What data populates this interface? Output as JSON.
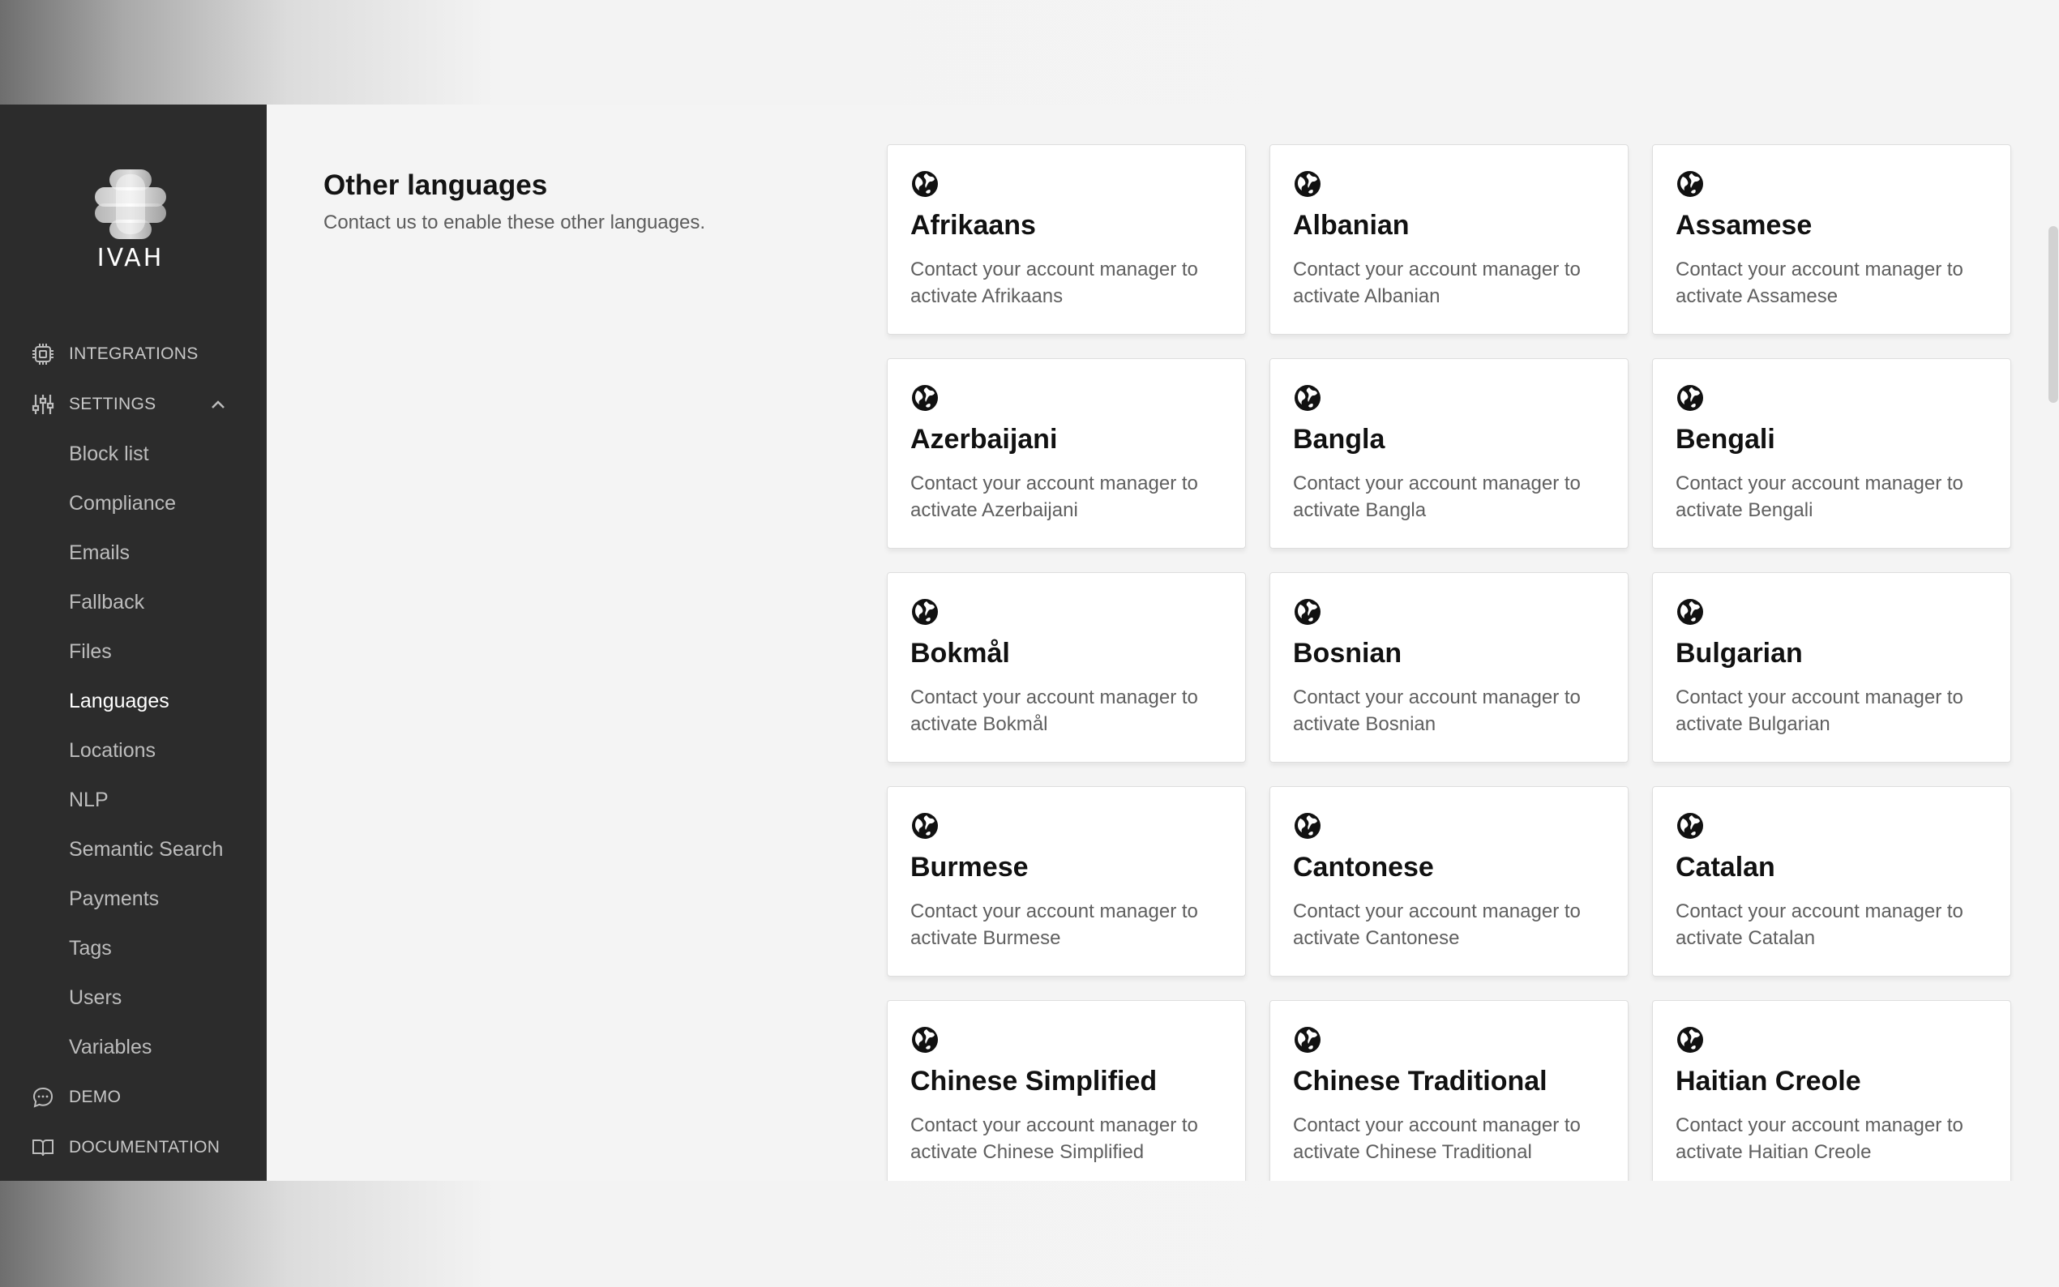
{
  "brand": {
    "name": "IVAH"
  },
  "nav": {
    "integrations": "INTEGRATIONS",
    "settings": "SETTINGS",
    "settings_items": [
      "Block list",
      "Compliance",
      "Emails",
      "Fallback",
      "Files",
      "Languages",
      "Locations",
      "NLP",
      "Semantic Search",
      "Payments",
      "Tags",
      "Users",
      "Variables"
    ],
    "active_item": "Languages",
    "demo": "DEMO",
    "documentation": "DOCUMENTATION"
  },
  "section": {
    "title": "Other languages",
    "description": "Contact us to enable these other languages."
  },
  "languages": [
    {
      "name": "Afrikaans",
      "desc": "Contact your account manager to activate Afrikaans"
    },
    {
      "name": "Albanian",
      "desc": "Contact your account manager to activate Albanian"
    },
    {
      "name": "Assamese",
      "desc": "Contact your account manager to activate Assamese"
    },
    {
      "name": "Azerbaijani",
      "desc": "Contact your account manager to activate Azerbaijani"
    },
    {
      "name": "Bangla",
      "desc": "Contact your account manager to activate Bangla"
    },
    {
      "name": "Bengali",
      "desc": "Contact your account manager to activate Bengali"
    },
    {
      "name": "Bokmål",
      "desc": "Contact your account manager to activate Bokmål"
    },
    {
      "name": "Bosnian",
      "desc": "Contact your account manager to activate Bosnian"
    },
    {
      "name": "Bulgarian",
      "desc": "Contact your account manager to activate Bulgarian"
    },
    {
      "name": "Burmese",
      "desc": "Contact your account manager to activate Burmese"
    },
    {
      "name": "Cantonese",
      "desc": "Contact your account manager to activate Cantonese"
    },
    {
      "name": "Catalan",
      "desc": "Contact your account manager to activate Catalan"
    },
    {
      "name": "Chinese Simplified",
      "desc": "Contact your account manager to activate Chinese Simplified"
    },
    {
      "name": "Chinese Traditional",
      "desc": "Contact your account manager to activate Chinese Traditional"
    },
    {
      "name": "Haitian Creole",
      "desc": "Contact your account manager to activate Haitian Creole"
    }
  ],
  "colors": {
    "sidebar": "#2c2c2c",
    "active_text": "#ffffff",
    "card_bg": "#ffffff"
  },
  "icons": {
    "card_icon": "globe-icon",
    "integrations_icon": "chip-icon",
    "settings_icon": "sliders-icon",
    "demo_icon": "chat-bubble-icon",
    "docs_icon": "book-icon"
  }
}
